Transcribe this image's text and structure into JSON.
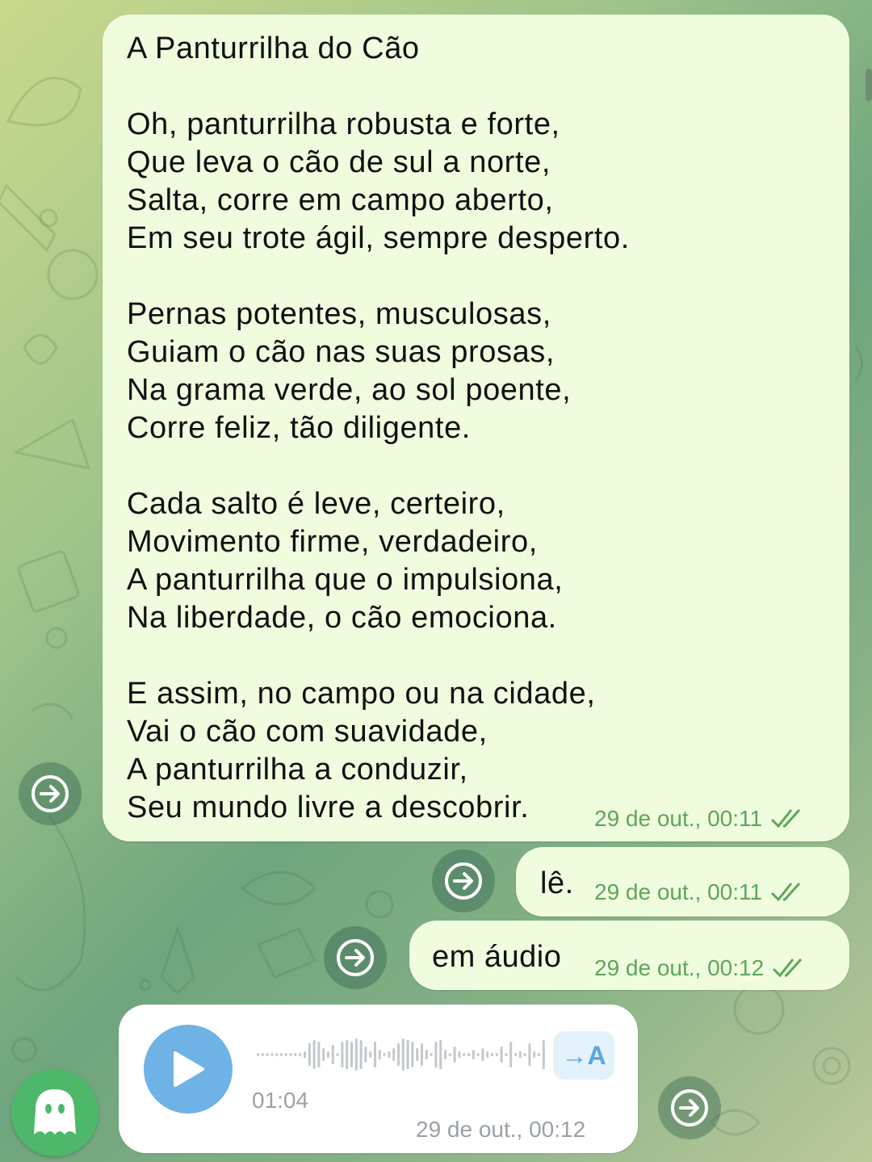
{
  "poem": {
    "lines": [
      "A Panturrilha do Cão",
      "",
      "Oh, panturrilha robusta e forte,",
      "Que leva o cão de sul a norte,",
      "Salta, corre em campo aberto,",
      "Em seu trote ágil, sempre desperto.",
      "",
      "Pernas potentes, musculosas,",
      "Guiam o cão nas suas prosas,",
      "Na grama verde, ao sol poente,",
      "Corre feliz, tão diligente.",
      "",
      "Cada salto é leve, certeiro,",
      "Movimento firme, verdadeiro,",
      "A panturrilha que o impulsiona,",
      "Na liberdade, o cão emociona.",
      "",
      "E assim, no campo ou na cidade,",
      "Vai o cão com suavidade,",
      "A panturrilha a conduzir,",
      "Seu mundo livre a descobrir."
    ],
    "time": "29 de out., 00:11",
    "status_icon": "double-check-icon"
  },
  "msg_le": {
    "text": "lê.",
    "time": "29 de out., 00:11",
    "status_icon": "double-check-icon"
  },
  "msg_audio_req": {
    "text": "em áudio",
    "time": "29 de out., 00:12",
    "status_icon": "double-check-icon"
  },
  "voice": {
    "duration": "01:04",
    "time": "29 de out., 00:12",
    "transcribe_label": "→A",
    "play_icon": "play-icon"
  },
  "icons": {
    "forward": "forward-arrow-icon",
    "ghost": "ghost-icon"
  },
  "colors": {
    "outgoing_bubble": "#effdde",
    "incoming_bubble": "#ffffff",
    "time_green": "#5fa55a",
    "play_blue": "#6fb2e6",
    "ghost_green": "#4db86a"
  }
}
